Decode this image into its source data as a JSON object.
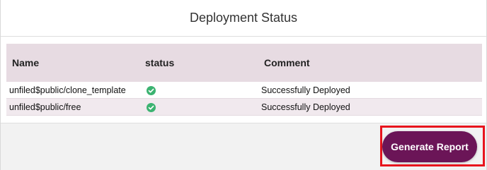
{
  "dialog": {
    "title": "Deployment Status"
  },
  "table": {
    "headers": {
      "name": "Name",
      "status": "status",
      "comment": "Comment"
    },
    "rows": [
      {
        "name": "unfiled$public/clone_template",
        "status_icon": "check-circle-icon",
        "comment": "Successfully Deployed"
      },
      {
        "name": "unfiled$public/free",
        "status_icon": "check-circle-icon",
        "comment": "Successfully Deployed"
      }
    ]
  },
  "footer": {
    "generate_report_label": "Generate Report"
  },
  "colors": {
    "accent": "#6b1557",
    "header_row": "#e7dbe2",
    "success": "#3cb371",
    "highlight": "#e8141d"
  }
}
